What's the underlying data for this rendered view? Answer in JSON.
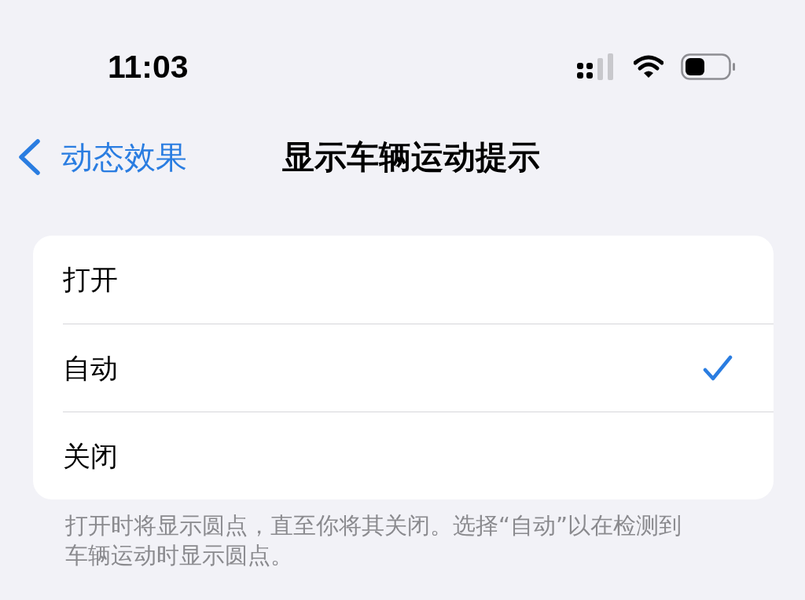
{
  "status_bar": {
    "time": "11:03"
  },
  "nav": {
    "back_label": "动态效果",
    "title": "显示车辆运动提示"
  },
  "options": [
    {
      "label": "打开",
      "selected": false
    },
    {
      "label": "自动",
      "selected": true
    },
    {
      "label": "关闭",
      "selected": false
    }
  ],
  "footer": "打开时将显示圆点，直至你将其关闭。选择“自动”以在检测到车辆运动时显示圆点。"
}
